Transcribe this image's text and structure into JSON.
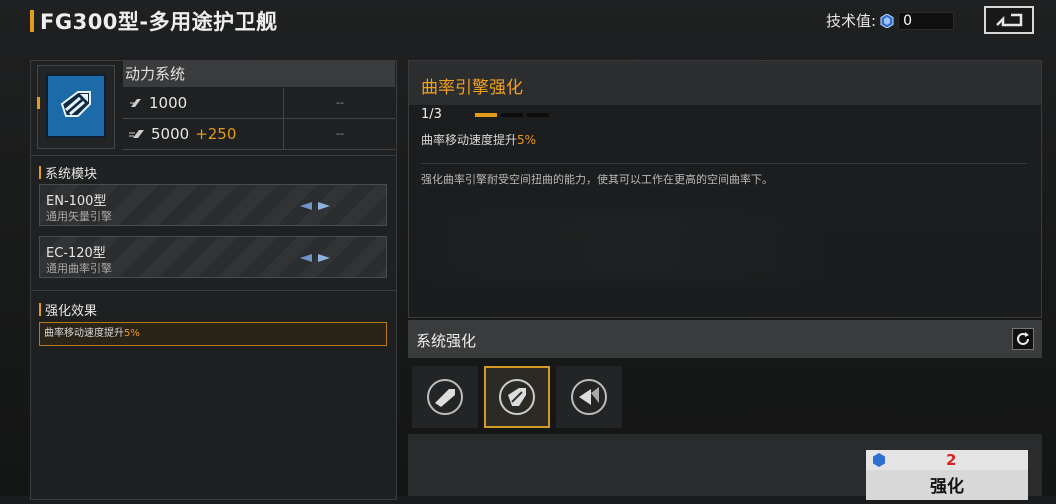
{
  "header": {
    "title": "FG300型-多用途护卫舰",
    "tech_label": "技术值:",
    "tech_value": "0"
  },
  "system": {
    "name": "动力系统",
    "stats": [
      {
        "value": "1000",
        "bonus": "",
        "right": "--"
      },
      {
        "value": "5000",
        "bonus": "+250",
        "right": "--"
      }
    ],
    "modules_title": "系统模块",
    "modules": [
      {
        "name": "EN-100型",
        "sub": "通用矢量引擎"
      },
      {
        "name": "EC-120型",
        "sub": "通用曲率引擎"
      }
    ],
    "effect_title": "强化效果",
    "effect_text": "曲率移动速度提升",
    "effect_pct": "5%"
  },
  "detail": {
    "title": "曲率引擎强化",
    "level": "1/3",
    "desc_prefix": "曲率移动速度提升",
    "desc_pct": "5%",
    "long_desc": "强化曲率引擎耐受空间扭曲的能力，使其可以工作在更高的空间曲率下。",
    "level_fill": 0.333
  },
  "enhance": {
    "title": "系统强化",
    "options": [
      "thruster-icon",
      "warp-engine-icon",
      "engine-upgrade-icon"
    ],
    "cost": "2",
    "button": "强化"
  },
  "colors": {
    "accent": "#e69a1a",
    "icon_blue": "#1d6aa8"
  }
}
